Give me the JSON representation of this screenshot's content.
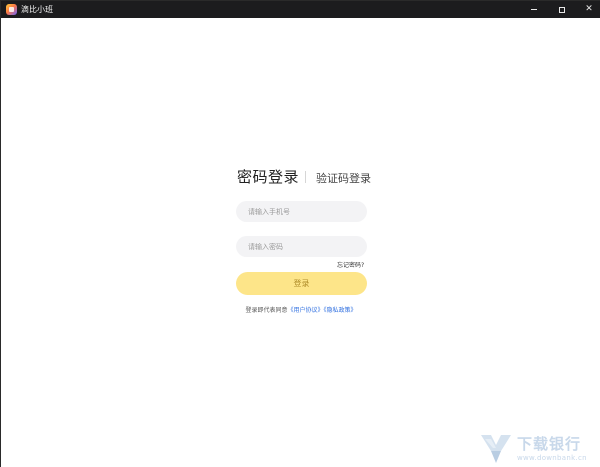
{
  "window": {
    "title": "滴比小班",
    "minimize_label": "",
    "maximize_label": "",
    "close_label": "✕"
  },
  "login": {
    "tab_password": "密码登录",
    "tab_code": "验证码登录",
    "phone_placeholder": "请输入手机号",
    "password_placeholder": "请输入密码",
    "forgot_label": "忘记密码?",
    "submit_label": "登录",
    "agreement_prefix": "登录即代表同意",
    "user_agreement": "《用户协议》",
    "privacy_policy": "《隐私政策》"
  },
  "watermark": {
    "title": "下载银行",
    "url": "www.downbank.cn"
  },
  "colors": {
    "titlebar": "#1c1c1e",
    "button_bg": "#fde589",
    "button_text": "#b08d2a",
    "link": "#2f6fe0",
    "input_bg": "#f3f3f5"
  }
}
